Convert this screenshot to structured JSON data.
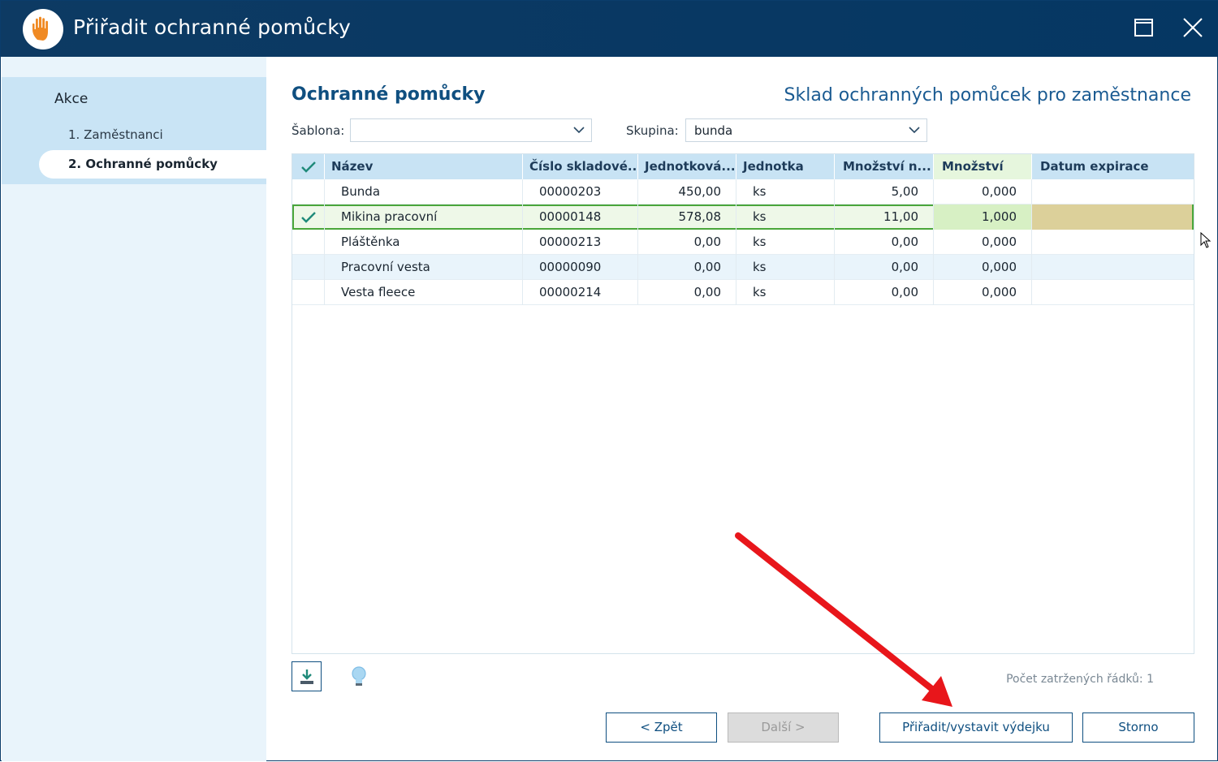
{
  "window": {
    "title": "Přiřadit ochranné pomůcky",
    "icon": "hand-icon",
    "controls": [
      "maximize-icon",
      "close-icon"
    ]
  },
  "sidebar": {
    "heading": "Akce",
    "items": [
      {
        "label": "1. Zaměstnanci",
        "active": false
      },
      {
        "label": "2. Ochranné pomůcky",
        "active": true
      }
    ]
  },
  "main": {
    "title": "Ochranné pomůcky",
    "subtitle": "Sklad ochranných pomůcek pro zaměstnance",
    "filters": {
      "template_label": "Šablona:",
      "template_value": "",
      "group_label": "Skupina:",
      "group_value": "bunda"
    }
  },
  "grid": {
    "columns": [
      "Název",
      "Číslo skladové...",
      "Jednotková...",
      "Jednotka",
      "Množství n...",
      "Množství",
      "Datum expirace"
    ],
    "rows": [
      {
        "checked": false,
        "name": "Bunda",
        "number": "00000203",
        "unit_price": "450,00",
        "unit": "ks",
        "stock_qty": "5,00",
        "qty": "0,000",
        "expiry": ""
      },
      {
        "checked": true,
        "name": "Mikina pracovní",
        "number": "00000148",
        "unit_price": "578,08",
        "unit": "ks",
        "stock_qty": "11,00",
        "qty": "1,000",
        "expiry": ""
      },
      {
        "checked": false,
        "name": "Pláštěnka",
        "number": "00000213",
        "unit_price": "0,00",
        "unit": "ks",
        "stock_qty": "0,00",
        "qty": "0,000",
        "expiry": ""
      },
      {
        "checked": false,
        "name": "Pracovní vesta",
        "number": "00000090",
        "unit_price": "0,00",
        "unit": "ks",
        "stock_qty": "0,00",
        "qty": "0,000",
        "expiry": ""
      },
      {
        "checked": false,
        "name": "Vesta fleece",
        "number": "00000214",
        "unit_price": "0,00",
        "unit": "ks",
        "stock_qty": "0,00",
        "qty": "0,000",
        "expiry": ""
      }
    ]
  },
  "footer": {
    "checked_count": "Počet zatržených řádků: 1",
    "back_label": "< Zpět",
    "next_label": "Další >",
    "assign_label": "Přiřadit/vystavit výdejku",
    "cancel_label": "Storno"
  },
  "colors": {
    "titlebar": "#053763",
    "accent": "#0f4f80",
    "selected_row_border": "#4aa63a",
    "annotation_arrow": "#e8161b"
  }
}
